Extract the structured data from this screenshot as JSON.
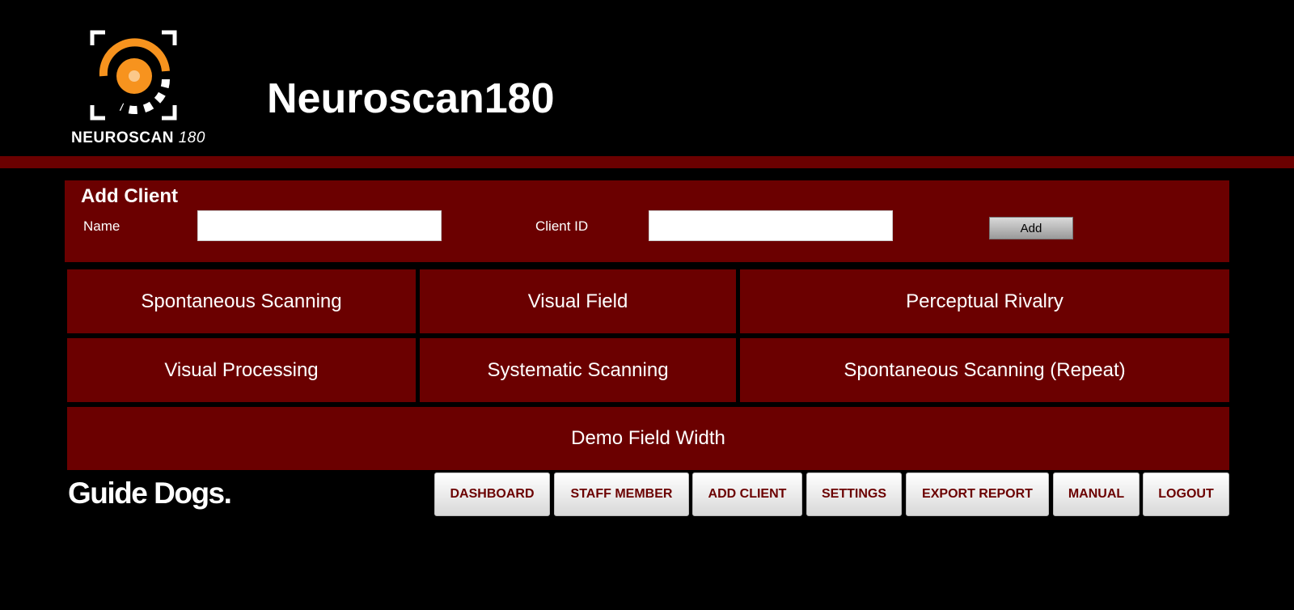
{
  "app": {
    "title": "Neuroscan180",
    "logo_text": "NEUROSCAN",
    "logo_number": "180"
  },
  "add_client": {
    "title": "Add Client",
    "name_label": "Name",
    "name_value": "",
    "client_id_label": "Client ID",
    "client_id_value": "",
    "add_button": "Add"
  },
  "tests": [
    {
      "label": "Spontaneous Scanning"
    },
    {
      "label": "Visual Field"
    },
    {
      "label": "Perceptual Rivalry"
    },
    {
      "label": "Visual Processing"
    },
    {
      "label": "Systematic Scanning"
    },
    {
      "label": "Spontaneous Scanning (Repeat)"
    },
    {
      "label": "Demo Field Width"
    }
  ],
  "footer": {
    "brand": "Guide Dogs.",
    "nav": [
      {
        "label": "DASHBOARD"
      },
      {
        "label": "STAFF MEMBER"
      },
      {
        "label": "ADD CLIENT"
      },
      {
        "label": "SETTINGS"
      },
      {
        "label": "EXPORT REPORT"
      },
      {
        "label": "MANUAL"
      },
      {
        "label": "LOGOUT"
      }
    ]
  },
  "colors": {
    "background": "#000000",
    "panel": "#6b0000",
    "logo_orange": "#f7931e",
    "nav_text": "#6b0000"
  },
  "icons": {
    "logo": "target-eye-icon"
  }
}
